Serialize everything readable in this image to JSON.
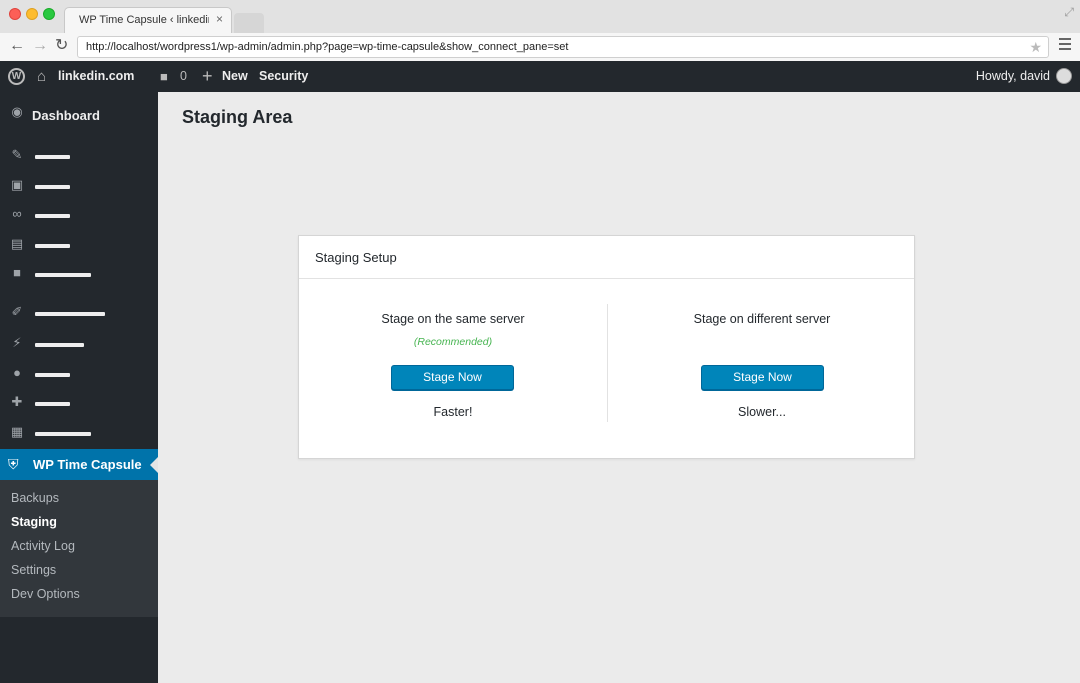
{
  "browser": {
    "tab_title": "WP Time Capsule ‹ linkedin.c",
    "tab_close": "×",
    "url": "http://localhost/wordpress1/wp-admin/admin.php?page=wp-time-capsule&show_connect_pane=set"
  },
  "adminbar": {
    "site_name": "linkedin.com",
    "comment_count": "0",
    "new_label": "New",
    "security_label": "Security",
    "howdy": "Howdy, david"
  },
  "sidebar": {
    "dashboard": "Dashboard",
    "active": "WP Time Capsule",
    "submenu": [
      "Backups",
      "Staging",
      "Activity Log",
      "Settings",
      "Dev Options"
    ]
  },
  "main": {
    "page_title": "Staging Area",
    "card_title": "Staging Setup",
    "left": {
      "title": "Stage on the same server",
      "note": "(Recommended)",
      "button": "Stage Now",
      "speed": "Faster!"
    },
    "right": {
      "title": "Stage on different server",
      "button": "Stage Now",
      "speed": "Slower..."
    }
  },
  "colors": {
    "accent": "#0073aa",
    "button": "#0085ba",
    "recommended": "#46b450",
    "adminbar": "#23282d"
  }
}
